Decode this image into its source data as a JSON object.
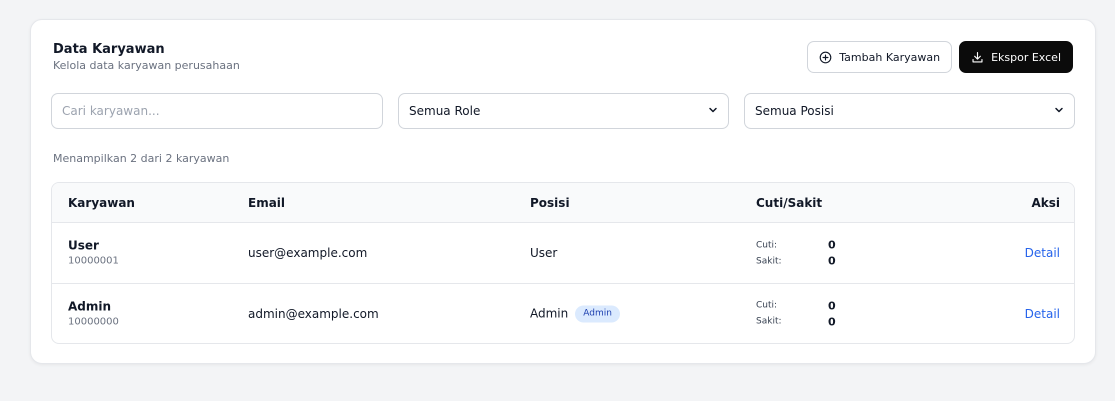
{
  "header": {
    "title": "Data Karyawan",
    "subtitle": "Kelola data karyawan perusahaan"
  },
  "actions": {
    "add_label": "Tambah Karyawan",
    "export_label": "Ekspor Excel"
  },
  "filters": {
    "search_placeholder": "Cari karyawan...",
    "role_selected": "Semua Role",
    "position_selected": "Semua Posisi"
  },
  "result_count": "Menampilkan 2 dari 2 karyawan",
  "table": {
    "headers": [
      "Karyawan",
      "Email",
      "Posisi",
      "Cuti/Sakit",
      "Aksi"
    ],
    "rows": [
      {
        "name": "User",
        "id": "10000001",
        "email": "user@example.com",
        "position": "User",
        "badge": "",
        "cuti_label": "Cuti:",
        "cuti_value": "0",
        "sakit_label": "Sakit:",
        "sakit_value": "0",
        "action": "Detail"
      },
      {
        "name": "Admin",
        "id": "10000000",
        "email": "admin@example.com",
        "position": "Admin",
        "badge": "Admin",
        "cuti_label": "Cuti:",
        "cuti_value": "0",
        "sakit_label": "Sakit:",
        "sakit_value": "0",
        "action": "Detail"
      }
    ]
  },
  "colors": {
    "page_bg": "#f3f4f6",
    "dark_button": "#0b0b0b",
    "link": "#2563eb",
    "badge_bg": "#dbeafe",
    "badge_text": "#1e40af"
  },
  "icons": {
    "add": "plus-circle-icon",
    "export": "download-icon",
    "select": "chevron-down-icon"
  }
}
